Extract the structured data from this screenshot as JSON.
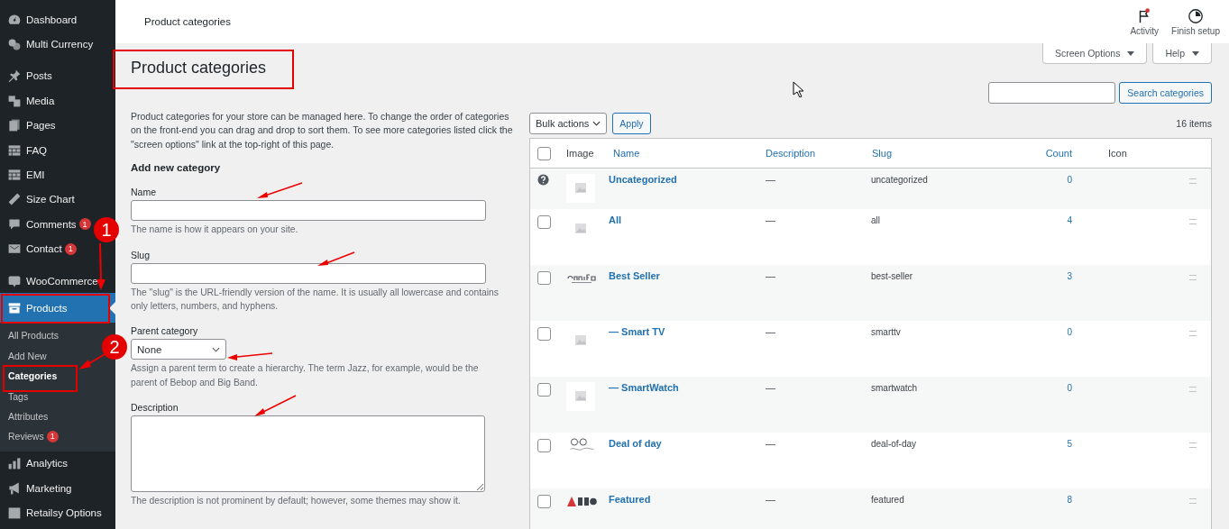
{
  "sidebar": {
    "groups": [
      [
        {
          "label": "Dashboard",
          "selected": false
        },
        {
          "label": "Multi Currency",
          "selected": false
        }
      ],
      [
        {
          "label": "Posts",
          "selected": false
        },
        {
          "label": "Media",
          "selected": false
        },
        {
          "label": "Pages",
          "selected": false
        },
        {
          "label": "FAQ",
          "selected": false
        },
        {
          "label": "EMI",
          "selected": false
        },
        {
          "label": "Size Chart",
          "selected": false
        },
        {
          "label": "Comments",
          "badge": "1",
          "selected": false
        },
        {
          "label": "Contact",
          "badge": "1",
          "selected": false
        }
      ],
      [
        {
          "label": "WooCommerce",
          "selected": false
        },
        {
          "label": "Products",
          "selected": true,
          "children": [
            {
              "label": "All Products",
              "selected": false
            },
            {
              "label": "Add New",
              "selected": false
            },
            {
              "label": "Categories",
              "selected": true
            },
            {
              "label": "Tags",
              "selected": false
            },
            {
              "label": "Attributes",
              "selected": false
            },
            {
              "label": "Reviews",
              "badge": "1",
              "selected": false
            }
          ]
        },
        {
          "label": "Analytics",
          "selected": false
        },
        {
          "label": "Marketing",
          "selected": false
        },
        {
          "label": "Retailsy Options",
          "selected": false
        }
      ]
    ]
  },
  "top_bar": {
    "title": "Product categories",
    "actions": [
      {
        "label": "Activity",
        "notification": true
      },
      {
        "label": "Finish setup",
        "notification": false
      }
    ]
  },
  "screen_links": [
    "Screen Options",
    "Help"
  ],
  "heading": "Product categories",
  "intro": "Product categories for your store can be managed here. To change the order of categories on the front-end you can drag and drop to sort them. To see more categories listed click the \"screen options\" link at the top-right of this page.",
  "form": {
    "title": "Add new category",
    "fields": [
      {
        "kind": "text",
        "label": "Name",
        "help": "The name is how it appears on your site."
      },
      {
        "kind": "text",
        "label": "Slug",
        "help": "The \"slug\" is the URL-friendly version of the name. It is usually all lowercase and contains only letters, numbers, and hyphens."
      },
      {
        "kind": "select",
        "label": "Parent category",
        "value": "None",
        "help": "Assign a parent term to create a hierarchy. The term Jazz, for example, would be the parent of Bebop and Big Band."
      },
      {
        "kind": "textarea",
        "label": "Description",
        "help": "The description is not prominent by default; however, some themes may show it."
      }
    ]
  },
  "search": {
    "button": "Search categories"
  },
  "bulk": {
    "value": "Bulk actions",
    "apply": "Apply"
  },
  "count": "16 items",
  "table": {
    "select_all_checked": false,
    "columns": [
      "Image",
      "Name",
      "Description",
      "Slug",
      "Count",
      "Icon"
    ],
    "rows": [
      {
        "kind": "default",
        "name": "Uncategorized",
        "description": "—",
        "slug": "uncategorized",
        "count": "0"
      },
      {
        "kind": "category",
        "name": "All",
        "description": "—",
        "slug": "all",
        "count": "4",
        "checked": false
      },
      {
        "kind": "category",
        "name": "Best Seller",
        "description": "—",
        "slug": "best-seller",
        "count": "3",
        "checked": false
      },
      {
        "kind": "category",
        "name": "— Smart TV",
        "description": "—",
        "slug": "smarttv",
        "count": "0",
        "checked": false
      },
      {
        "kind": "category",
        "name": "— SmartWatch",
        "description": "—",
        "slug": "smartwatch",
        "count": "0",
        "checked": false
      },
      {
        "kind": "category",
        "name": "Deal of day",
        "description": "—",
        "slug": "deal-of-day",
        "count": "5",
        "checked": false
      },
      {
        "kind": "category",
        "name": "Featured",
        "description": "—",
        "slug": "featured",
        "count": "8",
        "checked": false
      }
    ]
  },
  "annotations": {
    "markers": [
      "1",
      "2"
    ]
  }
}
